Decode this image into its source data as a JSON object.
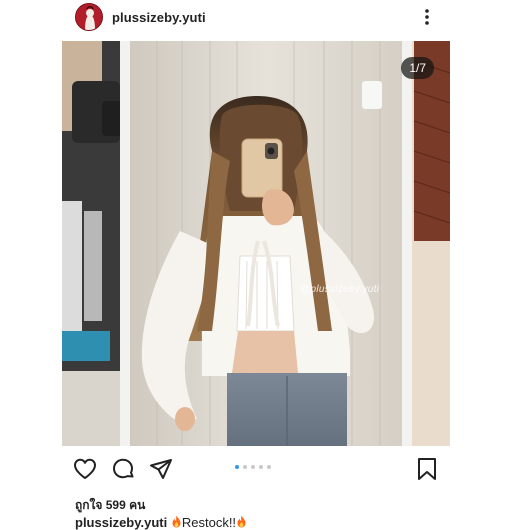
{
  "post": {
    "username": "plussizeby.yuti",
    "more_icon": "more-vertical-icon",
    "image_counter": "1/7",
    "watermark": "@plussizeby.yuti",
    "carousel": {
      "total": 5,
      "active_index": 0
    },
    "likes_text": "ถูกใจ 599 คน",
    "caption_user": "plussizeby.yuti",
    "caption_text": "Restock!!",
    "caption_emoji": "fire-icon"
  },
  "actions": {
    "like_icon": "heart-icon",
    "comment_icon": "comment-icon",
    "share_icon": "send-icon",
    "save_icon": "bookmark-icon"
  },
  "colors": {
    "accent_blue": "#3897f0",
    "avatar_red": "#b11d2a",
    "flame": "#ff6a1a"
  }
}
